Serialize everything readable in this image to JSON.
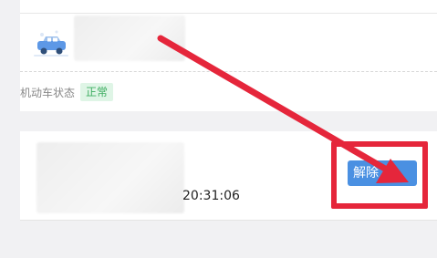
{
  "vehicle": {
    "status_label": "机动车状态",
    "status_value": "正常"
  },
  "record": {
    "time": "20:31:06",
    "unbind_label": "解除"
  },
  "icons": {
    "vehicle": "car-icon",
    "annotation": "arrow-icon"
  },
  "colors": {
    "accent": "#4a90e2",
    "status_ok": "#3fae62",
    "status_ok_bg": "#dff5e6",
    "annotation": "#e5263b"
  }
}
